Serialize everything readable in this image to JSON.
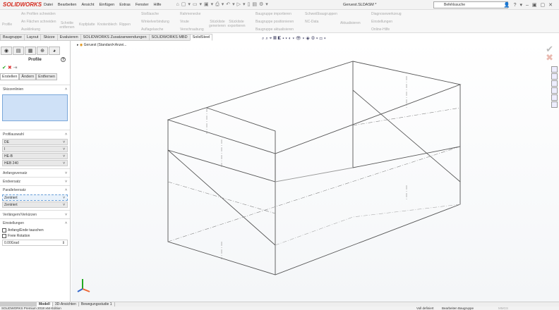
{
  "app": {
    "logo": "SOLIDWORKS",
    "title": "Geruest.SLDASM *",
    "search_placeholder": "Befehlssuche"
  },
  "menu": [
    "Datei",
    "Bearbeiten",
    "Ansicht",
    "Einfügen",
    "Extras",
    "Fenster",
    "Hilfe"
  ],
  "ribbon": {
    "profile": "Profile",
    "an_profilen": "An Profilen schneiden",
    "an_flaechen": "An Flächen schneiden",
    "ausklinkung": "Ausklinkung",
    "schnitte": "Schnitte entfernen",
    "kopfplatte": "Kopfplatte",
    "knotenblech": "Knotenblech",
    "rippen": "Rippen",
    "stosslasche": "Stoßlasche",
    "winkelverbindung": "Winkelverbindung",
    "auflagelasche": "Auflagelasche",
    "rahmenecke": "Rahmenecke",
    "voute": "Voute",
    "verschraubung": "Verschraubung",
    "stueckliste_gen": "Stückliste generieren",
    "stueckliste_exp": "Stückliste exportieren",
    "bg_import": "Baugruppe importieren",
    "bg_pos": "Baugruppe positionieren",
    "bg_akt": "Baugruppe aktualisieren",
    "schweiss": "Schweißbaugruppen",
    "nc": "NC-Data",
    "aktualisieren": "Aktualisieren",
    "diagnose": "Diagnosewerkzeug",
    "einstellungen": "Einstellungen",
    "hilfe": "Online-Hilfe"
  },
  "tabs": [
    "Baugruppe",
    "Layout",
    "Skizze",
    "Evaluieren",
    "SOLIDWORKS Zusatzanwendungen",
    "SOLIDWORKS MBD",
    "SolidSteel"
  ],
  "panel": {
    "title": "Profile",
    "subtabs": [
      "Erstellen",
      "Ändern",
      "Entfernen"
    ],
    "skizzenlinien": "Skizzenlinien",
    "profilauswahl": "Profilauswahl",
    "profile_values": [
      "DE",
      "I",
      "HE-B",
      "HEB 240"
    ],
    "anfangsversatz": "Anfangsversatz",
    "endversatz": "Endversatz",
    "parallelversatz": "Parallelversatz",
    "parallel_values": [
      "Zentriert",
      "Zentriert"
    ],
    "verlaengern": "Verlängern/Verkürzen",
    "einstellungen": "Einstellungen",
    "cb1": "Anfang/Ende tauschen",
    "cb2": "Freie Rotation",
    "angle": "0.00Grad"
  },
  "view": {
    "tree": "Geruest  (Standard<Anzei..."
  },
  "bottom_tabs": [
    "Modell",
    "3D-Ansichten",
    "Bewegungsstudie 1"
  ],
  "status": {
    "edition": "SOLIDWORKS Premium 2018 x64-Edition",
    "defined": "Voll definiert",
    "mode": "Bearbeiten Baugruppe",
    "units": "MMGS"
  }
}
